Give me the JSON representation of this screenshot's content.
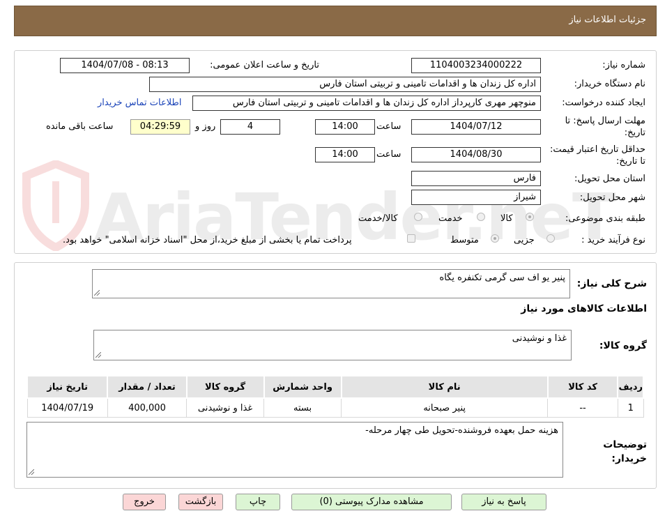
{
  "header": {
    "title": "جزئیات اطلاعات نیاز"
  },
  "watermark": {
    "text": "AriaTender.neT"
  },
  "form": {
    "need_number_label": "شماره نیاز:",
    "need_number": "1104003234000222",
    "announce_label": "تاریخ و ساعت اعلان عمومی:",
    "announce_value": "1404/07/08 - 08:13",
    "buyer_org_label": "نام دستگاه خریدار:",
    "buyer_org": "اداره کل زندان ها و اقدامات تامینی و تربیتی استان فارس",
    "requester_label": "ایجاد کننده درخواست:",
    "requester": "منوچهر  مهری  کارپرداز اداره کل زندان ها و اقدامات تامینی و تربیتی استان فارس",
    "contact_link": "اطلاعات تماس خریدار",
    "deadline_label": "مهلت ارسال پاسخ: تا تاریخ:",
    "deadline_date": "1404/07/12",
    "time_label": "ساعت",
    "deadline_time": "14:00",
    "days_value": "4",
    "days_label": "روز و",
    "remaining_time": "04:29:59",
    "remaining_label": "ساعت باقی مانده",
    "validity_label": "حداقل تاریخ اعتبار قیمت: تا تاریخ:",
    "validity_date": "1404/08/30",
    "validity_time": "14:00",
    "province_label": "استان محل تحویل:",
    "province": "فارس",
    "city_label": "شهر محل تحویل:",
    "city": "شیراز",
    "category_label": "طبقه بندی موضوعی:",
    "category_options": [
      "کالا",
      "خدمت",
      "کالا/خدمت"
    ],
    "process_label": "نوع فرآیند خرید :",
    "process_options": [
      "جزیی",
      "متوسط"
    ],
    "payment_note": "پرداخت تمام یا بخشی از مبلغ خرید،از محل \"اسناد خزانه اسلامی\" خواهد بود."
  },
  "details": {
    "summary_label": "شرح کلی نیاز:",
    "summary_value": "پنیر یو اف سی گرمی تکنفره یگاه",
    "goods_info_title": "اطلاعات کالاهای مورد نیاز",
    "goods_group_label": "گروه کالا:",
    "goods_group_value": "غذا و نوشیدنی",
    "table": {
      "headers": [
        "ردیف",
        "کد کالا",
        "نام کالا",
        "واحد شمارش",
        "گروه کالا",
        "تعداد / مقدار",
        "تاریخ نیاز"
      ],
      "rows": [
        [
          "1",
          "--",
          "پنیر صبحانه",
          "بسته",
          "غذا و نوشیدنی",
          "400,000",
          "1404/07/19"
        ]
      ]
    },
    "buyer_notes_label": "توضیحات خریدار:",
    "buyer_notes_value": "هزینه حمل بعهده فروشنده-تحویل طی چهار مرحله-"
  },
  "buttons": {
    "reply": "پاسخ به نیاز",
    "attachments": "مشاهده مدارک پیوستی (0)",
    "print": "چاپ",
    "back": "بازگشت",
    "exit": "خروج"
  },
  "colors": {
    "header_bg": "#8a6a47",
    "link": "#1a43b8",
    "green_button": "#dcf5d4",
    "pink_button": "#fbd6d6",
    "remaining_bg": "#ffffcc"
  }
}
